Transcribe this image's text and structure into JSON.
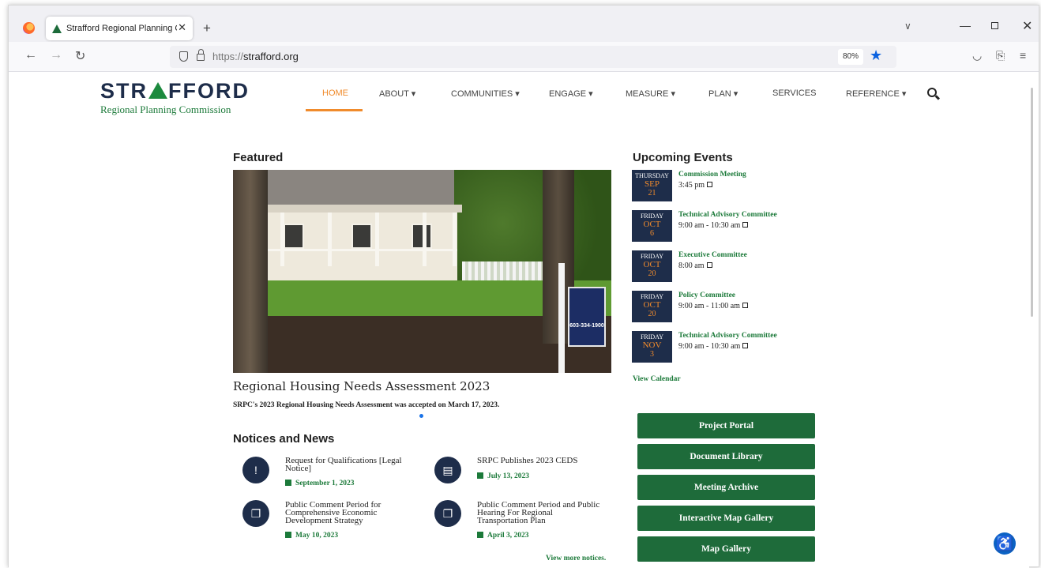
{
  "browser": {
    "tab_title": "Strafford Regional Planning Co",
    "url_scheme": "https://",
    "url_host": "strafford.org",
    "zoom": "80%",
    "icons": [
      "firefox-icon",
      "close-icon",
      "plus-icon",
      "chevron-down-icon",
      "back-icon",
      "forward-icon",
      "reload-icon",
      "shield-icon",
      "lock-icon",
      "star-icon",
      "pocket-icon",
      "extensions-icon",
      "menu-icon"
    ]
  },
  "site": {
    "logo_left": "STR",
    "logo_right": "FFORD",
    "logo_sub": "Regional Planning Commission"
  },
  "nav": [
    {
      "label": "HOME"
    },
    {
      "label": "ABOUT ▾"
    },
    {
      "label": "COMMUNITIES ▾"
    },
    {
      "label": "ENGAGE ▾"
    },
    {
      "label": "MEASURE ▾"
    },
    {
      "label": "PLAN ▾"
    },
    {
      "label": "SERVICES"
    },
    {
      "label": "REFERENCE ▾"
    }
  ],
  "featured": {
    "heading": "Featured",
    "sign_text": "603-334-1900",
    "title": "Regional Housing Needs Assessment 2023",
    "subtitle": "SRPC's 2023 Regional Housing Needs Assessment was accepted on March 17, 2023."
  },
  "notices": {
    "heading": "Notices and News",
    "items": [
      {
        "title": "Request for Qualifications [Legal Notice]",
        "date": "September 1, 2023",
        "icon": "chat-alert-icon"
      },
      {
        "title": "SRPC Publishes 2023 CEDS",
        "date": "July 13, 2023",
        "icon": "document-icon"
      },
      {
        "title": "Public Comment Period for Comprehensive Economic Development Strategy",
        "date": "May 10, 2023",
        "icon": "comments-icon"
      },
      {
        "title": "Public Comment Period and Public Hearing For Regional Transportation Plan",
        "date": "April 3, 2023",
        "icon": "comments-icon"
      }
    ],
    "view_more": "View more notices."
  },
  "events": {
    "heading": "Upcoming Events",
    "items": [
      {
        "dow": "THURSDAY",
        "mon": "SEP",
        "day": "21",
        "title": "Commission Meeting",
        "time": "3:45 pm"
      },
      {
        "dow": "FRIDAY",
        "mon": "OCT",
        "day": "6",
        "title": "Technical Advisory Committee",
        "time": "9:00 am - 10:30 am"
      },
      {
        "dow": "FRIDAY",
        "mon": "OCT",
        "day": "20",
        "title": "Executive Committee",
        "time": "8:00 am"
      },
      {
        "dow": "FRIDAY",
        "mon": "OCT",
        "day": "20",
        "title": "Policy Committee",
        "time": "9:00 am - 11:00 am"
      },
      {
        "dow": "FRIDAY",
        "mon": "NOV",
        "day": "3",
        "title": "Technical Advisory Committee",
        "time": "9:00 am - 10:30 am"
      }
    ],
    "view_calendar": "View Calendar"
  },
  "quick_links": [
    "Project Portal",
    "Document Library",
    "Meeting Archive",
    "Interactive Map Gallery",
    "Map Gallery"
  ],
  "colors": {
    "brand_green": "#1e6b3a",
    "brand_navy": "#1e2d4a",
    "accent_orange": "#f08b2c"
  }
}
